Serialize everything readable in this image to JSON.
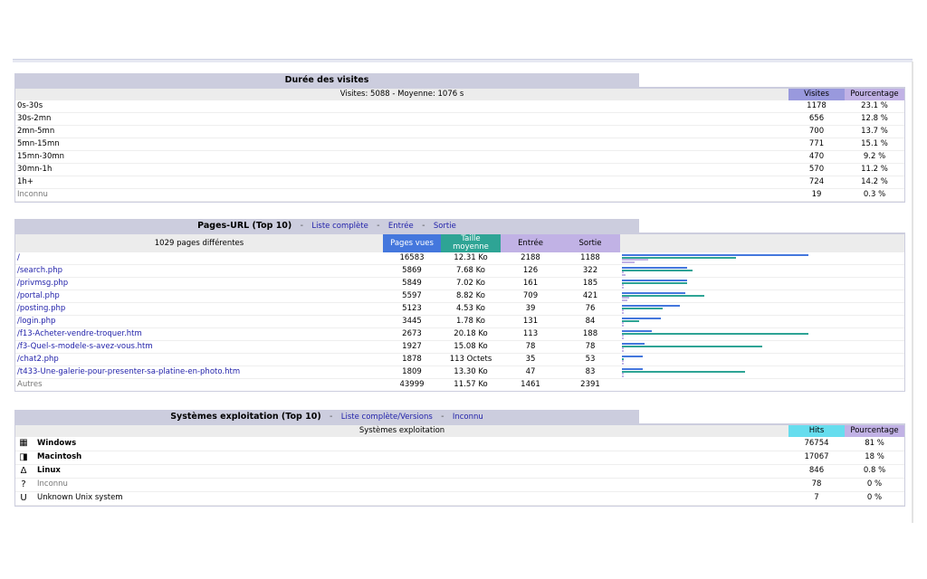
{
  "duree": {
    "title": "Durée des visites",
    "summary": "Visites: 5088 - Moyenne: 1076 s",
    "col_visites": "Visites",
    "col_pct": "Pourcentage",
    "rows": [
      {
        "label": "0s-30s",
        "visites": "1178",
        "pct": "23.1 %"
      },
      {
        "label": "30s-2mn",
        "visites": "656",
        "pct": "12.8 %"
      },
      {
        "label": "2mn-5mn",
        "visites": "700",
        "pct": "13.7 %"
      },
      {
        "label": "5mn-15mn",
        "visites": "771",
        "pct": "15.1 %"
      },
      {
        "label": "15mn-30mn",
        "visites": "470",
        "pct": "9.2 %"
      },
      {
        "label": "30mn-1h",
        "visites": "570",
        "pct": "11.2 %"
      },
      {
        "label": "1h+",
        "visites": "724",
        "pct": "14.2 %"
      },
      {
        "label": "Inconnu",
        "visites": "19",
        "pct": "0.3 %"
      }
    ]
  },
  "pages": {
    "title": "Pages-URL (Top 10)",
    "link_full": "Liste complète",
    "link_entree": "Entrée",
    "link_sortie": "Sortie",
    "sep": "-",
    "summary": "1029 pages différentes",
    "col_pages": "Pages vues",
    "col_taille": "Taille moyenne",
    "col_entree": "Entrée",
    "col_sortie": "Sortie",
    "rows": [
      {
        "url": "/",
        "pages": "16583",
        "taille": "12.31 Ko",
        "entree": "2188",
        "sortie": "1188",
        "b": [
          1.0,
          0.61,
          0.14,
          0.07
        ]
      },
      {
        "url": "/search.php",
        "pages": "5869",
        "taille": "7.68 Ko",
        "entree": "126",
        "sortie": "322",
        "b": [
          0.35,
          0.38,
          0.01,
          0.02
        ]
      },
      {
        "url": "/privmsg.php",
        "pages": "5849",
        "taille": "7.02 Ko",
        "entree": "161",
        "sortie": "185",
        "b": [
          0.35,
          0.35,
          0.01,
          0.01
        ]
      },
      {
        "url": "/portal.php",
        "pages": "5597",
        "taille": "8.82 Ko",
        "entree": "709",
        "sortie": "421",
        "b": [
          0.34,
          0.44,
          0.04,
          0.03
        ]
      },
      {
        "url": "/posting.php",
        "pages": "5123",
        "taille": "4.53 Ko",
        "entree": "39",
        "sortie": "76",
        "b": [
          0.31,
          0.22,
          0.01,
          0.01
        ]
      },
      {
        "url": "/login.php",
        "pages": "3445",
        "taille": "1.78 Ko",
        "entree": "131",
        "sortie": "84",
        "b": [
          0.21,
          0.09,
          0.01,
          0.01
        ]
      },
      {
        "url": "/f13-Acheter-vendre-troquer.htm",
        "pages": "2673",
        "taille": "20.18 Ko",
        "entree": "113",
        "sortie": "188",
        "b": [
          0.16,
          1.0,
          0.01,
          0.01
        ]
      },
      {
        "url": "/f3-Quel-s-modele-s-avez-vous.htm",
        "pages": "1927",
        "taille": "15.08 Ko",
        "entree": "78",
        "sortie": "78",
        "b": [
          0.12,
          0.75,
          0.01,
          0.01
        ]
      },
      {
        "url": "/chat2.php",
        "pages": "1878",
        "taille": "113 Octets",
        "entree": "35",
        "sortie": "53",
        "b": [
          0.11,
          0.01,
          0.01,
          0.01
        ]
      },
      {
        "url": "/t433-Une-galerie-pour-presenter-sa-platine-en-photo.htm",
        "pages": "1809",
        "taille": "13.30 Ko",
        "entree": "47",
        "sortie": "83",
        "b": [
          0.11,
          0.66,
          0.01,
          0.01
        ]
      }
    ],
    "autres": {
      "label": "Autres",
      "pages": "43999",
      "taille": "11.57 Ko",
      "entree": "1461",
      "sortie": "2391"
    }
  },
  "os": {
    "title": "Systèmes exploitation (Top 10)",
    "link_full": "Liste complète/Versions",
    "link_inconnu": "Inconnu",
    "sep": "-",
    "summary": "Systèmes exploitation",
    "col_hits": "Hits",
    "col_pct": "Pourcentage",
    "rows": [
      {
        "icon": "windows-icon",
        "glyph": "▦",
        "label": "Windows",
        "hits": "76754",
        "pct": "81 %"
      },
      {
        "icon": "macintosh-icon",
        "glyph": "◨",
        "label": "Macintosh",
        "hits": "17067",
        "pct": "18 %"
      },
      {
        "icon": "linux-icon",
        "glyph": "Δ",
        "label": "Linux",
        "hits": "846",
        "pct": "0.8 %"
      },
      {
        "icon": "unknown-icon",
        "glyph": "?",
        "label": "Inconnu",
        "hits": "78",
        "pct": "0 %"
      },
      {
        "icon": "unix-icon",
        "glyph": "U",
        "label": "Unknown Unix system",
        "hits": "7",
        "pct": "0 %"
      }
    ]
  }
}
